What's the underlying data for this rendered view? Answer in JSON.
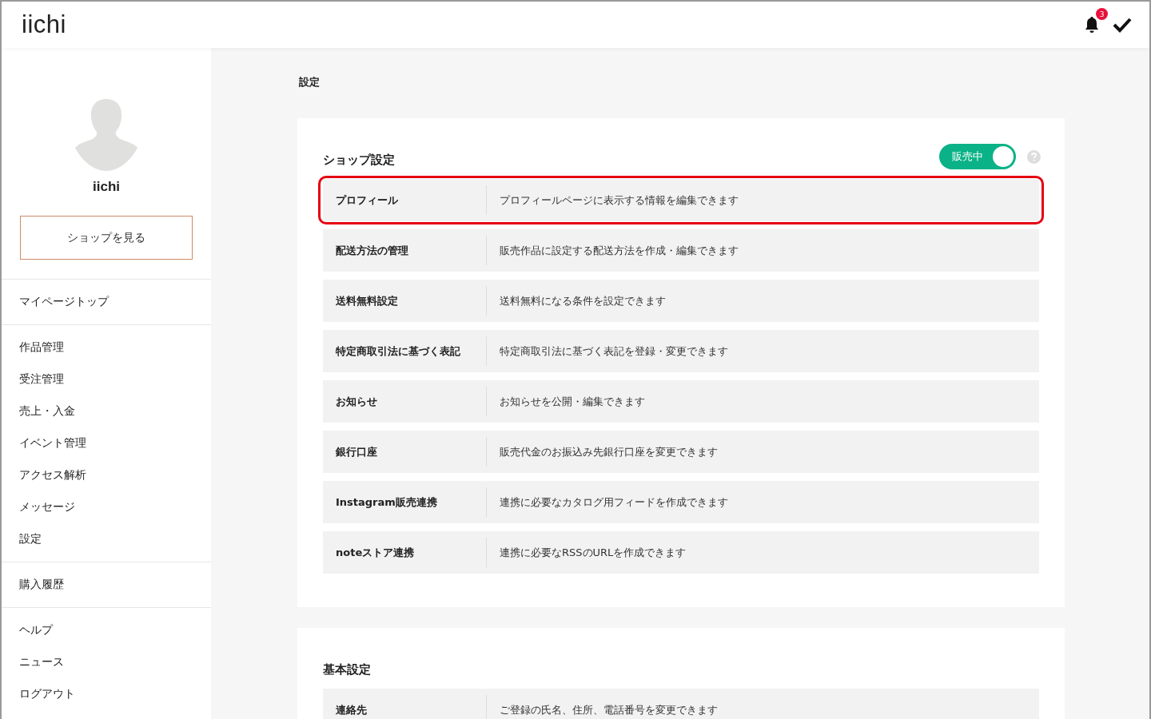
{
  "header": {
    "logo": "iichi",
    "notification_count": "3"
  },
  "sidebar": {
    "user_name": "iichi",
    "shop_button": "ショップを見る",
    "groups": [
      {
        "items": [
          {
            "label": "マイページトップ",
            "selected": false
          }
        ]
      },
      {
        "items": [
          {
            "label": "作品管理",
            "selected": false
          },
          {
            "label": "受注管理",
            "selected": false
          },
          {
            "label": "売上・入金",
            "selected": false
          },
          {
            "label": "イベント管理",
            "selected": false
          },
          {
            "label": "アクセス解析",
            "selected": false
          },
          {
            "label": "メッセージ",
            "selected": false
          },
          {
            "label": "設定",
            "selected": false
          }
        ]
      },
      {
        "items": [
          {
            "label": "購入履歴",
            "selected": false
          }
        ]
      },
      {
        "items": [
          {
            "label": "ヘルプ",
            "selected": false
          },
          {
            "label": "ニュース",
            "selected": false
          },
          {
            "label": "ログアウト",
            "selected": false
          }
        ]
      }
    ]
  },
  "breadcrumb": "設定",
  "sections": [
    {
      "title": "ショップ設定",
      "toggle": {
        "label": "販売中",
        "on": true
      },
      "rows": [
        {
          "label": "プロフィール",
          "description": "プロフィールページに表示する情報を編集できます",
          "highlighted": true
        },
        {
          "label": "配送方法の管理",
          "description": "販売作品に設定する配送方法を作成・編集できます",
          "highlighted": false
        },
        {
          "label": "送料無料設定",
          "description": "送料無料になる条件を設定できます",
          "highlighted": false
        },
        {
          "label": "特定商取引法に基づく表記",
          "description": "特定商取引法に基づく表記を登録・変更できます",
          "highlighted": false
        },
        {
          "label": "お知らせ",
          "description": "お知らせを公開・編集できます",
          "highlighted": false
        },
        {
          "label": "銀行口座",
          "description": "販売代金のお振込み先銀行口座を変更できます",
          "highlighted": false
        },
        {
          "label": "Instagram販売連携",
          "description": "連携に必要なカタログ用フィードを作成できます",
          "highlighted": false
        },
        {
          "label": "noteストア連携",
          "description": "連携に必要なRSSのURLを作成できます",
          "highlighted": false
        }
      ]
    },
    {
      "title": "基本設定",
      "rows": [
        {
          "label": "連絡先",
          "description": "ご登録の氏名、住所、電話番号を変更できます",
          "highlighted": false
        }
      ]
    }
  ]
}
